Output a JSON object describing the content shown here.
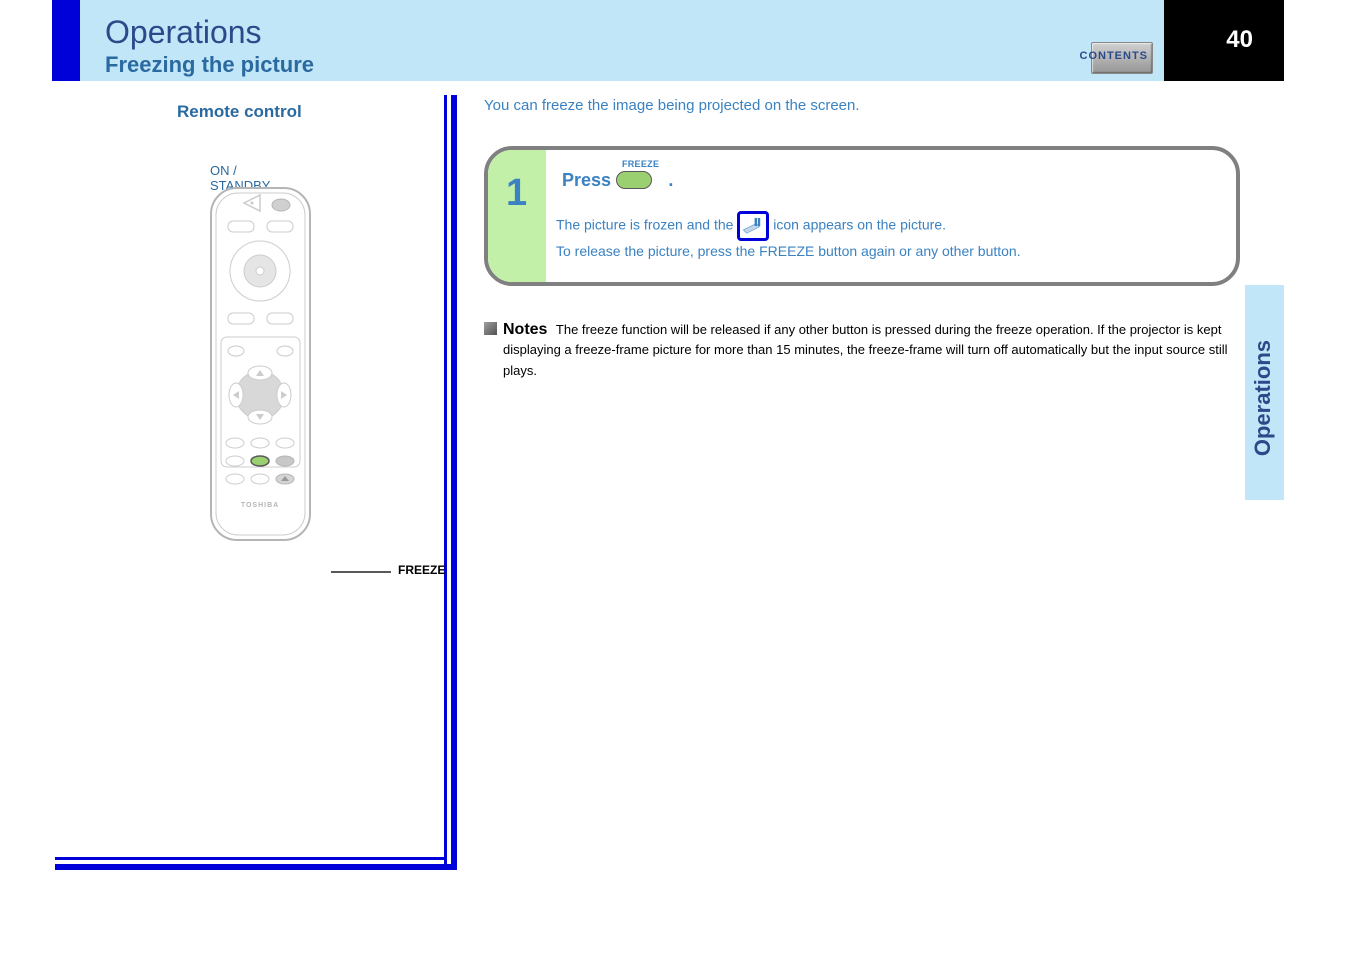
{
  "page_number": "40",
  "header": {
    "title": "Operations",
    "subtitle": "Freezing the picture"
  },
  "contents_label": "CONTENTS",
  "side_tab": "Operations",
  "left_panel": {
    "remote_label": "Remote control",
    "remote_sub": "ON /\nSTANDBY",
    "freeze_callout": "FREEZE"
  },
  "intro": "You can freeze the image being projected on the screen.",
  "step": {
    "number": "1",
    "freeze_word": "FREEZE",
    "title_prefix": "Press",
    "title_suffix": ".",
    "body_line1_a": "The picture is frozen and the",
    "body_line1_b": "icon appears on the",
    "body_line2": "picture.",
    "body_line3": "To release the picture, press the FREEZE button again or",
    "body_line4": "any other button."
  },
  "notes": {
    "label": "Notes",
    "body": "The freeze function will be released if any other button is pressed during the freeze operation. If the projector is kept displaying a freeze-frame picture for more than 15 minutes, the freeze-frame will turn off automatically but the input source still plays."
  }
}
